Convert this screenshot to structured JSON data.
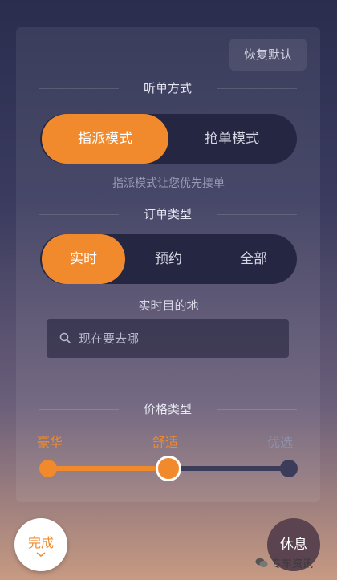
{
  "header": {
    "reset_label": "恢复默认"
  },
  "listening": {
    "title": "听单方式",
    "options": [
      "指派模式",
      "抢单模式"
    ],
    "selected": "指派模式",
    "hint": "指派模式让您优先接单"
  },
  "order_type": {
    "title": "订单类型",
    "options": [
      "实时",
      "预约",
      "全部"
    ],
    "selected": "实时"
  },
  "destination": {
    "title": "实时目的地",
    "placeholder": "现在要去哪"
  },
  "price": {
    "title": "价格类型",
    "options": [
      "豪华",
      "舒适",
      "优选"
    ],
    "selected": "舒适",
    "level": 0.5
  },
  "footer": {
    "done_label": "完成",
    "rest_label": "休息",
    "watermark": "专车资讯"
  },
  "colors": {
    "accent": "#f08a2c",
    "panel_dark": "#252642"
  }
}
